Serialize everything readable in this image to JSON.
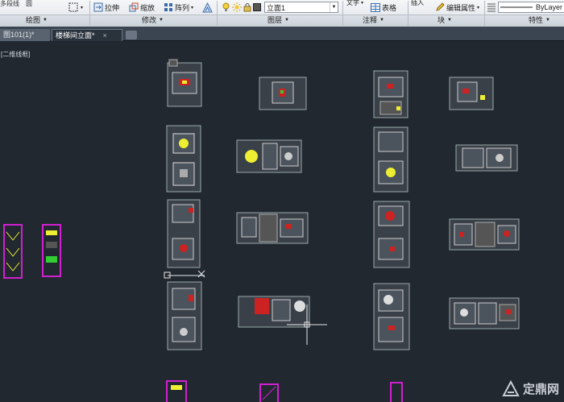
{
  "ribbon": {
    "draw_panel": {
      "title": "绘图",
      "top_left_1": "多段线",
      "top_left_2": "圆"
    },
    "modify_panel": {
      "title": "修改",
      "stretch": "拉伸",
      "scale": "缩放",
      "array": "阵列"
    },
    "layers_panel": {
      "title": "图层",
      "current_layer": "立面1"
    },
    "annotation_panel": {
      "title": "注释",
      "text": "文字",
      "table": "表格"
    },
    "block_panel": {
      "title": "块",
      "insert": "插入",
      "edit_attributes": "编辑属性"
    },
    "properties_panel": {
      "title": "特性",
      "linetype": "ByLayer"
    }
  },
  "tabs": [
    {
      "label": "图101(1)*",
      "active": false
    },
    {
      "label": "楼梯间立面*",
      "active": true
    }
  ],
  "canvas": {
    "viewport_label": "[二维线框]",
    "background": "#212830"
  },
  "watermark": {
    "text": "定鼎网"
  }
}
